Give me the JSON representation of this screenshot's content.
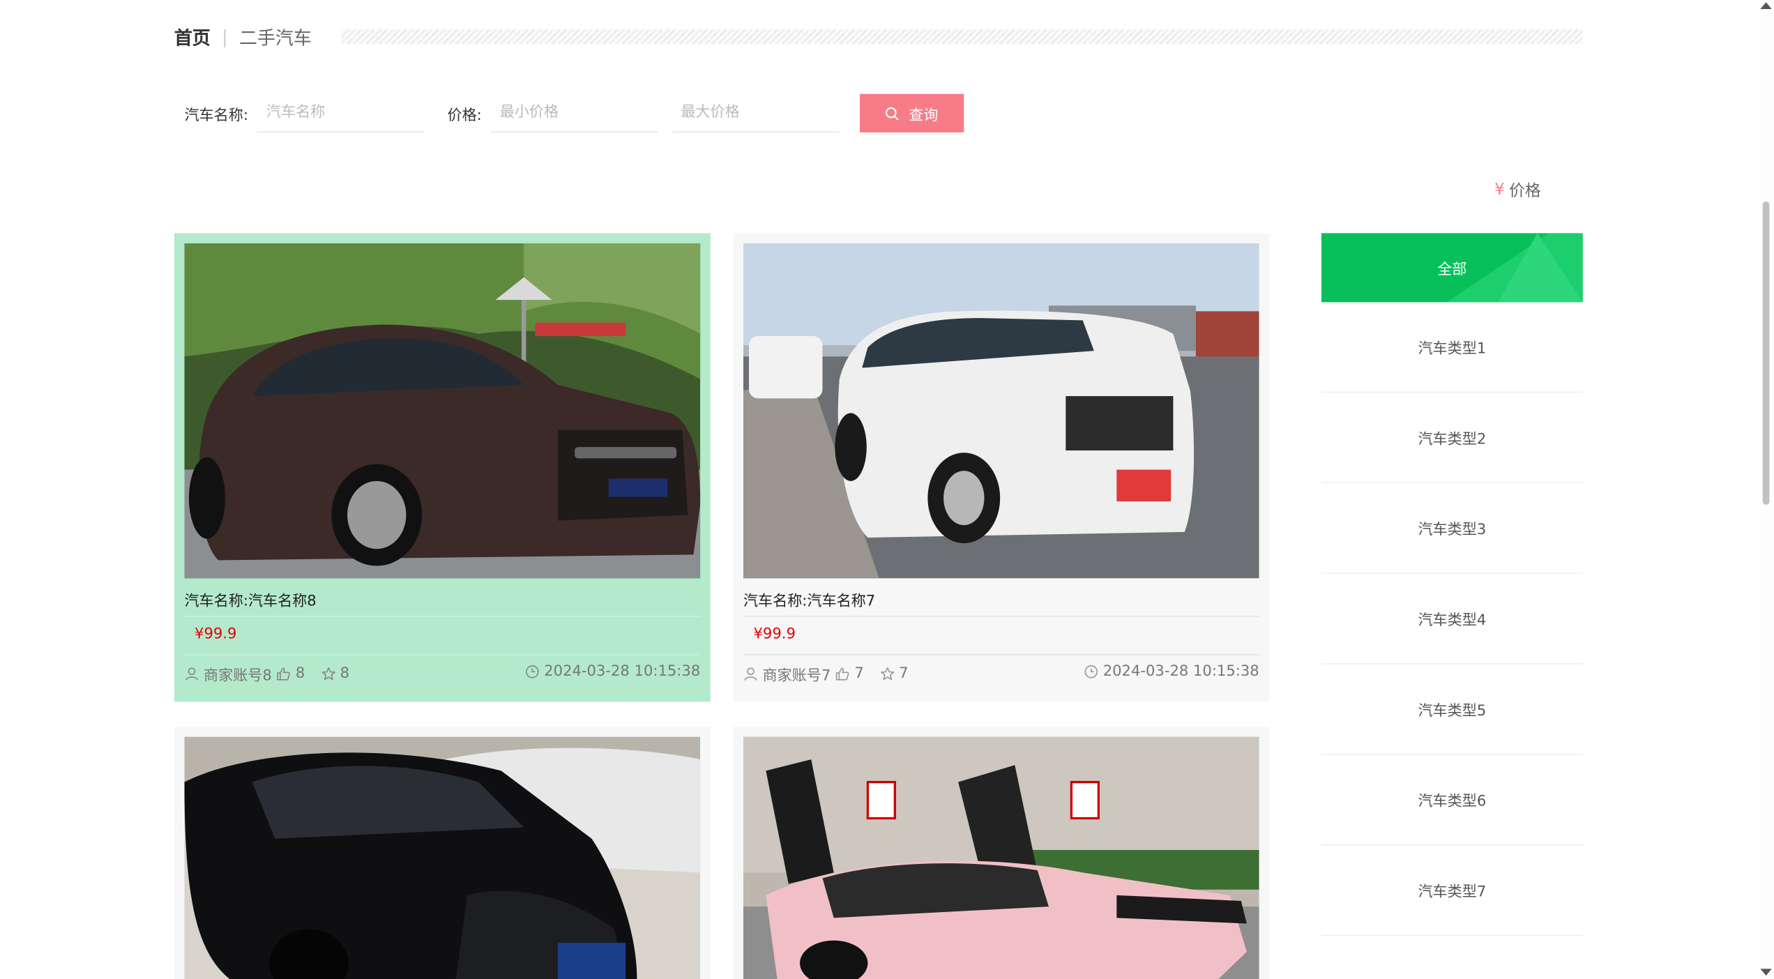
{
  "breadcrumb": {
    "home": "首页",
    "separator": "|",
    "current": "二手汽车"
  },
  "search": {
    "name_label": "汽车名称:",
    "name_placeholder": "汽车名称",
    "price_label": "价格:",
    "min_placeholder": "最小价格",
    "max_placeholder": "最大价格",
    "button_label": "查询"
  },
  "sort": {
    "symbol": "¥",
    "label": "价格"
  },
  "cards": [
    {
      "name": "汽车名称:汽车名称8",
      "price": "¥99.9",
      "seller": "商家账号8",
      "likes": "8",
      "favorites": "8",
      "time": "2024-03-28 10:15:38"
    },
    {
      "name": "汽车名称:汽车名称7",
      "price": "¥99.9",
      "seller": "商家账号7",
      "likes": "7",
      "favorites": "7",
      "time": "2024-03-28 10:15:38"
    },
    {
      "name": "",
      "price": "",
      "seller": "",
      "likes": "",
      "favorites": "",
      "time": ""
    },
    {
      "name": "",
      "price": "",
      "seller": "",
      "likes": "",
      "favorites": "",
      "time": ""
    }
  ],
  "sidebar": {
    "all_label": "全部",
    "items": [
      "汽车类型1",
      "汽车类型2",
      "汽车类型3",
      "汽车类型4",
      "汽车类型5",
      "汽车类型6",
      "汽车类型7"
    ]
  },
  "colors": {
    "accent": "#f87c87",
    "active_card": "#b3eacb",
    "sidebar_active": "#08c05a",
    "price": "#e3000b"
  },
  "icons": {
    "search": "search-icon",
    "user": "user-icon",
    "like": "thumbs-up-icon",
    "favorite": "star-icon",
    "time": "clock-icon"
  }
}
